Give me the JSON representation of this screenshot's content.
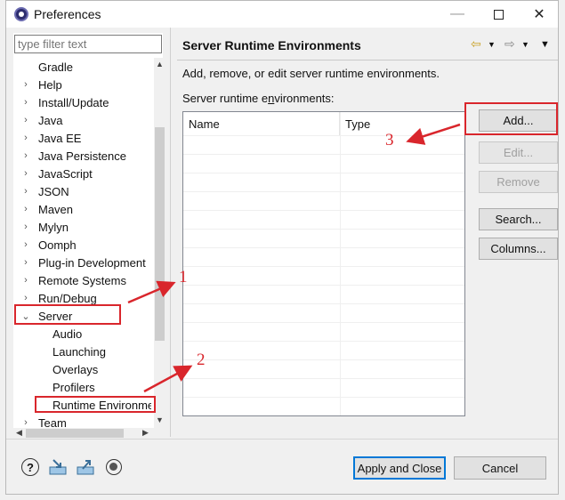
{
  "window": {
    "title": "Preferences",
    "minimize": "—",
    "close": "✕"
  },
  "left": {
    "filter_placeholder": "type filter text",
    "tree": [
      {
        "label": "Gradle",
        "chevron": "",
        "child": false
      },
      {
        "label": "Help",
        "chevron": "›",
        "child": false
      },
      {
        "label": "Install/Update",
        "chevron": "›",
        "child": false
      },
      {
        "label": "Java",
        "chevron": "›",
        "child": false
      },
      {
        "label": "Java EE",
        "chevron": "›",
        "child": false
      },
      {
        "label": "Java Persistence",
        "chevron": "›",
        "child": false
      },
      {
        "label": "JavaScript",
        "chevron": "›",
        "child": false
      },
      {
        "label": "JSON",
        "chevron": "›",
        "child": false
      },
      {
        "label": "Maven",
        "chevron": "›",
        "child": false
      },
      {
        "label": "Mylyn",
        "chevron": "›",
        "child": false
      },
      {
        "label": "Oomph",
        "chevron": "›",
        "child": false
      },
      {
        "label": "Plug-in Development",
        "chevron": "›",
        "child": false
      },
      {
        "label": "Remote Systems",
        "chevron": "›",
        "child": false
      },
      {
        "label": "Run/Debug",
        "chevron": "›",
        "child": false
      },
      {
        "label": "Server",
        "chevron": "⌄",
        "child": false
      },
      {
        "label": "Audio",
        "chevron": "",
        "child": true
      },
      {
        "label": "Launching",
        "chevron": "",
        "child": true
      },
      {
        "label": "Overlays",
        "chevron": "",
        "child": true
      },
      {
        "label": "Profilers",
        "chevron": "",
        "child": true
      },
      {
        "label": "Runtime Environme",
        "chevron": "",
        "child": true
      },
      {
        "label": "Team",
        "chevron": "›",
        "child": false
      }
    ]
  },
  "right": {
    "page_title": "Server Runtime Environments",
    "description": "Add, remove, or edit server runtime environments.",
    "table_label": "Server runtime environments:",
    "table": {
      "headers": [
        "Name",
        "Type"
      ],
      "rows": []
    },
    "buttons": {
      "add": "Add...",
      "edit": "Edit...",
      "remove": "Remove",
      "search": "Search...",
      "columns": "Columns..."
    }
  },
  "footer": {
    "apply_close": "Apply and Close",
    "cancel": "Cancel"
  },
  "annotations": {
    "labels": [
      "1",
      "2",
      "3"
    ],
    "color": "#d9262c"
  }
}
